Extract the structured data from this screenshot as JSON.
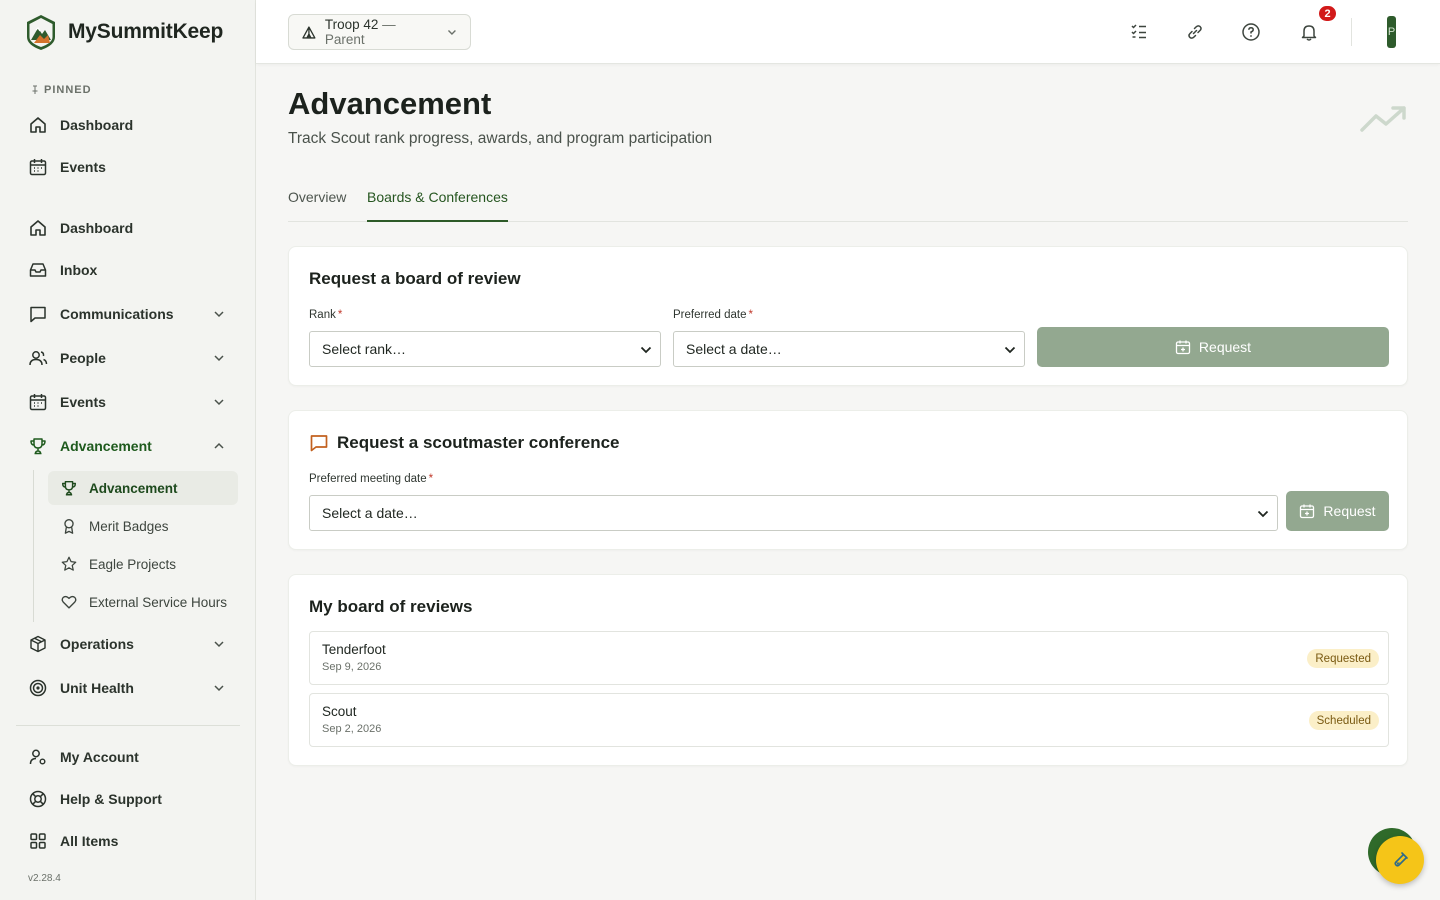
{
  "app": {
    "name": "MySummitKeep",
    "version": "v2.28.4"
  },
  "sidebar": {
    "pinned_label": "PINNED",
    "pinned": [
      {
        "label": "Dashboard",
        "icon": "home-icon"
      },
      {
        "label": "Events",
        "icon": "calendar-icon"
      }
    ],
    "items": [
      {
        "label": "Dashboard",
        "icon": "home-icon"
      },
      {
        "label": "Inbox",
        "icon": "inbox-icon"
      },
      {
        "label": "Communications",
        "icon": "message-icon",
        "expandable": true
      },
      {
        "label": "People",
        "icon": "users-icon",
        "expandable": true
      },
      {
        "label": "Events",
        "icon": "calendar-icon",
        "expandable": true
      },
      {
        "label": "Advancement",
        "icon": "trophy-icon",
        "expanded": true
      },
      {
        "label": "Operations",
        "icon": "box-icon",
        "expandable": true
      },
      {
        "label": "Unit Health",
        "icon": "target-icon",
        "expandable": true
      }
    ],
    "advancement_sub": [
      {
        "label": "Advancement",
        "icon": "trophy-icon",
        "active": true
      },
      {
        "label": "Merit Badges",
        "icon": "ribbon-icon"
      },
      {
        "label": "Eagle Projects",
        "icon": "star-icon"
      },
      {
        "label": "External Service Hours",
        "icon": "heart-icon"
      }
    ],
    "footer": [
      {
        "label": "My Account",
        "icon": "user-gear-icon"
      },
      {
        "label": "Help & Support",
        "icon": "lifebuoy-icon"
      },
      {
        "label": "All Items",
        "icon": "grid-icon"
      }
    ]
  },
  "topbar": {
    "troop": "Troop 42",
    "role": " — Parent",
    "notifications_count": "2",
    "avatar_initial": "P"
  },
  "page": {
    "title": "Advancement",
    "subtitle": "Track Scout rank progress, awards, and program participation",
    "tabs": [
      {
        "label": "Overview",
        "active": false
      },
      {
        "label": "Boards & Conferences",
        "active": true
      }
    ]
  },
  "board_request": {
    "title": "Request a board of review",
    "rank_label": "Rank",
    "rank_value": "Select rank…",
    "date_label": "Preferred date",
    "date_value": "Select a date…",
    "button": "Request"
  },
  "conference_request": {
    "title": "Request a scoutmaster conference",
    "date_label": "Preferred meeting date",
    "date_value": "Select a date…",
    "button": "Request"
  },
  "my_reviews": {
    "title": "My board of reviews",
    "rows": [
      {
        "rank": "Tenderfoot",
        "date": "Sep 9, 2026",
        "status": "Requested"
      },
      {
        "rank": "Scout",
        "date": "Sep 2, 2026",
        "status": "Scheduled"
      }
    ]
  },
  "colors": {
    "brand_green": "#2d5a27",
    "button_disabled": "#93a890",
    "badge_red": "#d21a1a",
    "status_bg": "#fbefc8"
  }
}
